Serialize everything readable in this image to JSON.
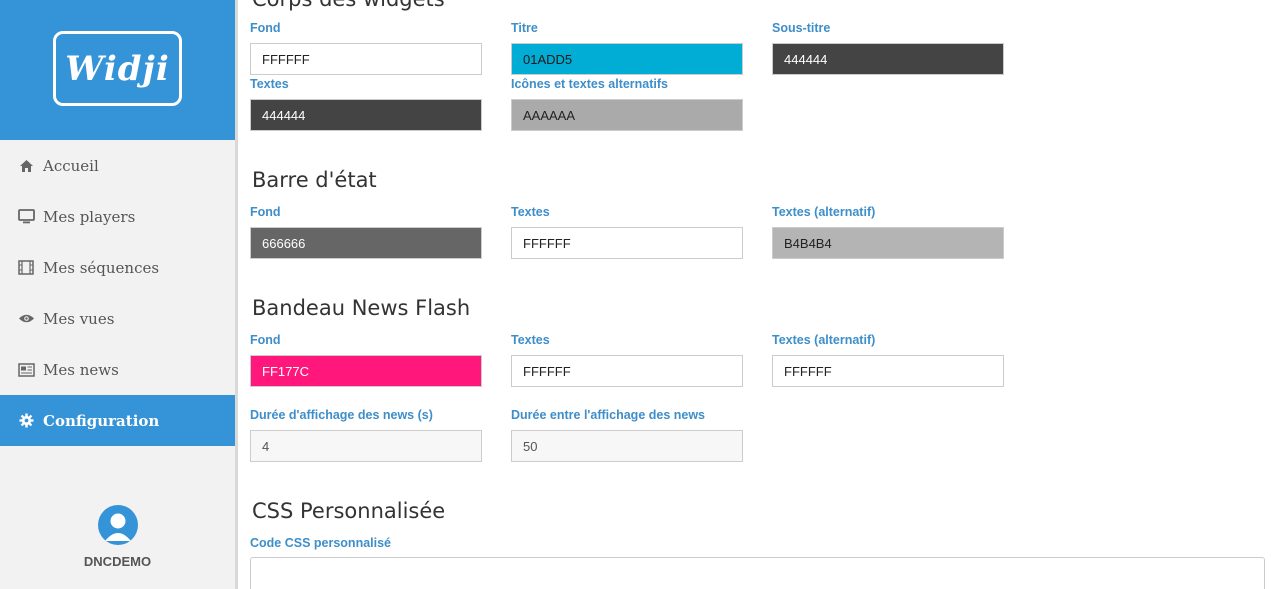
{
  "sidebar": {
    "logo": "Widji",
    "nav": [
      {
        "label": "Accueil",
        "icon": "home-icon"
      },
      {
        "label": "Mes players",
        "icon": "monitor-icon"
      },
      {
        "label": "Mes séquences",
        "icon": "film-icon"
      },
      {
        "label": "Mes vues",
        "icon": "eye-icon"
      },
      {
        "label": "Mes news",
        "icon": "newspaper-icon"
      },
      {
        "label": "Configuration",
        "icon": "gear-icon",
        "active": true
      }
    ],
    "user": {
      "name": "DNCDEMO"
    }
  },
  "sections": {
    "widgets": {
      "title": "Corps des widgets",
      "fields": [
        {
          "label": "Fond",
          "value": "FFFFFF",
          "bg": "#FFFFFF",
          "fg": "#222222"
        },
        {
          "label": "Titre",
          "value": "01ADD5",
          "bg": "#01ADD5",
          "fg": "#1a1a1a"
        },
        {
          "label": "Sous-titre",
          "value": "444444",
          "bg": "#444444",
          "fg": "#ffffff"
        },
        {
          "label": "Textes",
          "value": "444444",
          "bg": "#444444",
          "fg": "#ffffff"
        },
        {
          "label": "Icônes et textes alternatifs",
          "value": "AAAAAA",
          "bg": "#AAAAAA",
          "fg": "#222222"
        }
      ]
    },
    "status_bar": {
      "title": "Barre d'état",
      "fields": [
        {
          "label": "Fond",
          "value": "666666",
          "bg": "#666666",
          "fg": "#ffffff"
        },
        {
          "label": "Textes",
          "value": "FFFFFF",
          "bg": "#FFFFFF",
          "fg": "#222222"
        },
        {
          "label": "Textes (alternatif)",
          "value": "B4B4B4",
          "bg": "#B4B4B4",
          "fg": "#222222"
        }
      ]
    },
    "news_flash": {
      "title": "Bandeau News Flash",
      "fields": [
        {
          "label": "Fond",
          "value": "FF177C",
          "bg": "#FF177C",
          "fg": "#ffffff"
        },
        {
          "label": "Textes",
          "value": "FFFFFF",
          "bg": "#FFFFFF",
          "fg": "#222222"
        },
        {
          "label": "Textes (alternatif)",
          "value": "FFFFFF",
          "bg": "#FFFFFF",
          "fg": "#222222"
        }
      ],
      "durations": [
        {
          "label": "Durée d'affichage des news (s)",
          "value": "4"
        },
        {
          "label": "Durée entre l'affichage des news",
          "value": "50"
        }
      ]
    },
    "custom_css": {
      "title": "CSS Personnalisée",
      "label": "Code CSS personnalisé",
      "value": ""
    }
  }
}
